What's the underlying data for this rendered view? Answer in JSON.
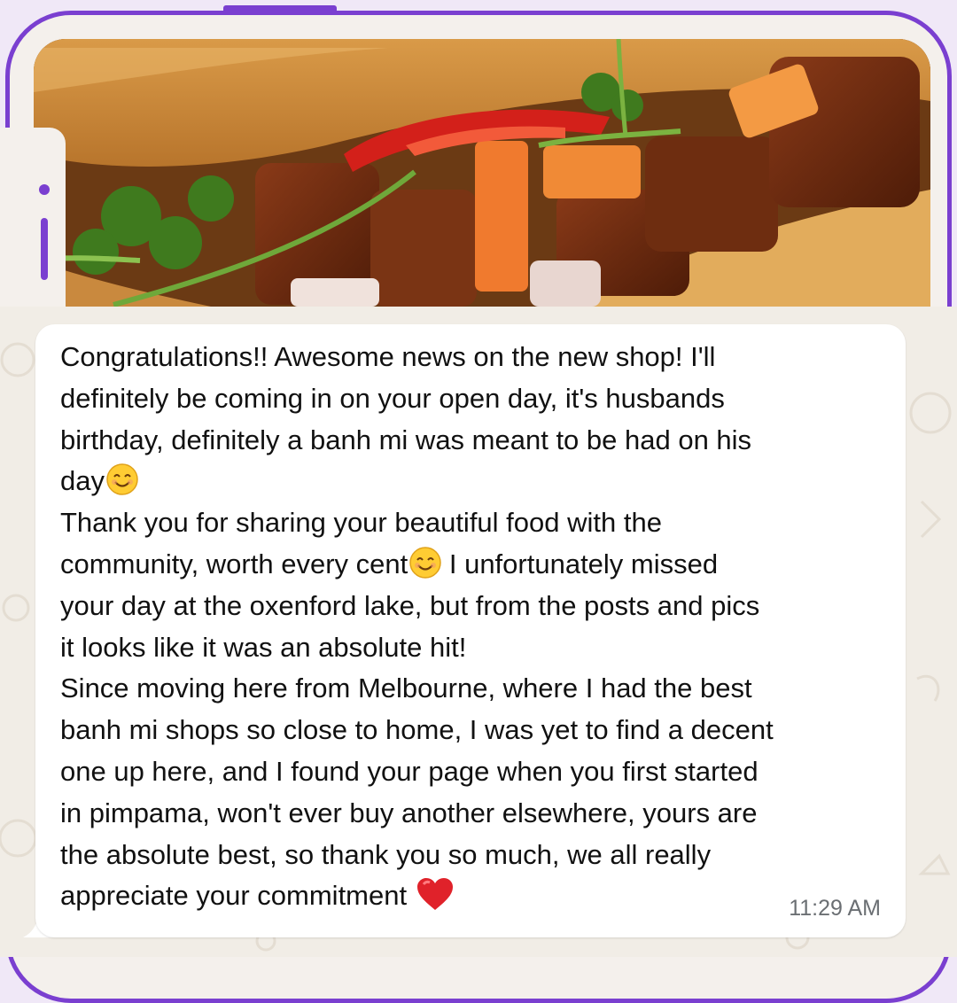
{
  "message": {
    "line1_a": "Congratulations!! Awesome news on the new shop! I'll",
    "line1_b": "definitely be coming in on your open day, it's husbands",
    "line1_c": "birthday, definitely a banh mi was meant to be had on his",
    "line1_d": "day",
    "para2_a": "Thank you for sharing your beautiful food with the",
    "para2_b": "community, worth every cent",
    "para2_c": " I unfortunately missed",
    "para2_d": "your day at the oxenford lake, but from the posts and pics",
    "para2_e": "it looks like it was an absolute hit!",
    "para3_a": "Since moving here from Melbourne, where I had the best",
    "para3_b": "banh mi shops so close to home, I was yet to find a decent",
    "para3_c": "one up here, and I found your page when you first started",
    "para3_d": "in pimpama, won't ever buy another elsewhere, yours are",
    "para3_e": "the absolute best, so thank you so much, we all really",
    "para3_f": "appreciate your commitment",
    "timestamp": "11:29 AM"
  },
  "icons": {
    "smile": "smiling-face-emoji",
    "heart": "red-heart-emoji"
  },
  "colors": {
    "frame_accent": "#7a3fd0",
    "bubble": "#ffffff",
    "chat_background": "#f1ede6",
    "timestamp": "#6b6f73"
  }
}
